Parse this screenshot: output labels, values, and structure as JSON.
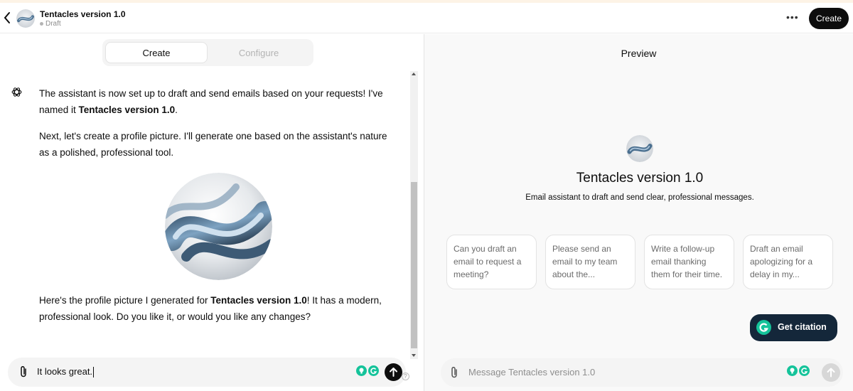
{
  "header": {
    "title": "Tentacles version 1.0",
    "status": "Draft",
    "more_label": "•••",
    "create_label": "Create"
  },
  "tabs": [
    {
      "label": "Create",
      "active": true
    },
    {
      "label": "Configure",
      "active": false
    }
  ],
  "conversation": {
    "para1_text": "The assistant is now set up to draft and send emails based on your requests! I've named it ",
    "para1_bold": "Tentacles version 1.0",
    "para1_end": ".",
    "para2": "Next, let's create a profile picture. I'll generate one based on the assistant's nature as a polished, professional tool.",
    "para3_text": "Here's the profile picture I generated for ",
    "para3_bold": "Tentacles version 1.0",
    "para3_end": "! It has a modern, professional look. Do you like it, or would you like any changes?"
  },
  "composer_left": {
    "value": "It looks great.",
    "help": "?"
  },
  "preview": {
    "title": "Preview",
    "gpt_name": "Tentacles version 1.0",
    "description": "Email assistant to draft and send clear, professional messages.",
    "starters": [
      "Can you draft an email to request a meeting?",
      "Please send an email to my team about the...",
      "Write a follow-up email thanking them for their time.",
      "Draft an email apologizing for a delay in my..."
    ],
    "citation_label": "Get citation",
    "placeholder": "Message Tentacles version 1.0"
  },
  "colors": {
    "accent_dark": "#0d0d0d",
    "grammarly_green": "#15c39a",
    "citation_bg": "#14273a"
  },
  "icons": [
    "back-chevron-icon",
    "paperclip-icon",
    "arrow-up-icon",
    "chatgpt-logo-icon",
    "grammarly-icon",
    "lightbulb-icon"
  ]
}
